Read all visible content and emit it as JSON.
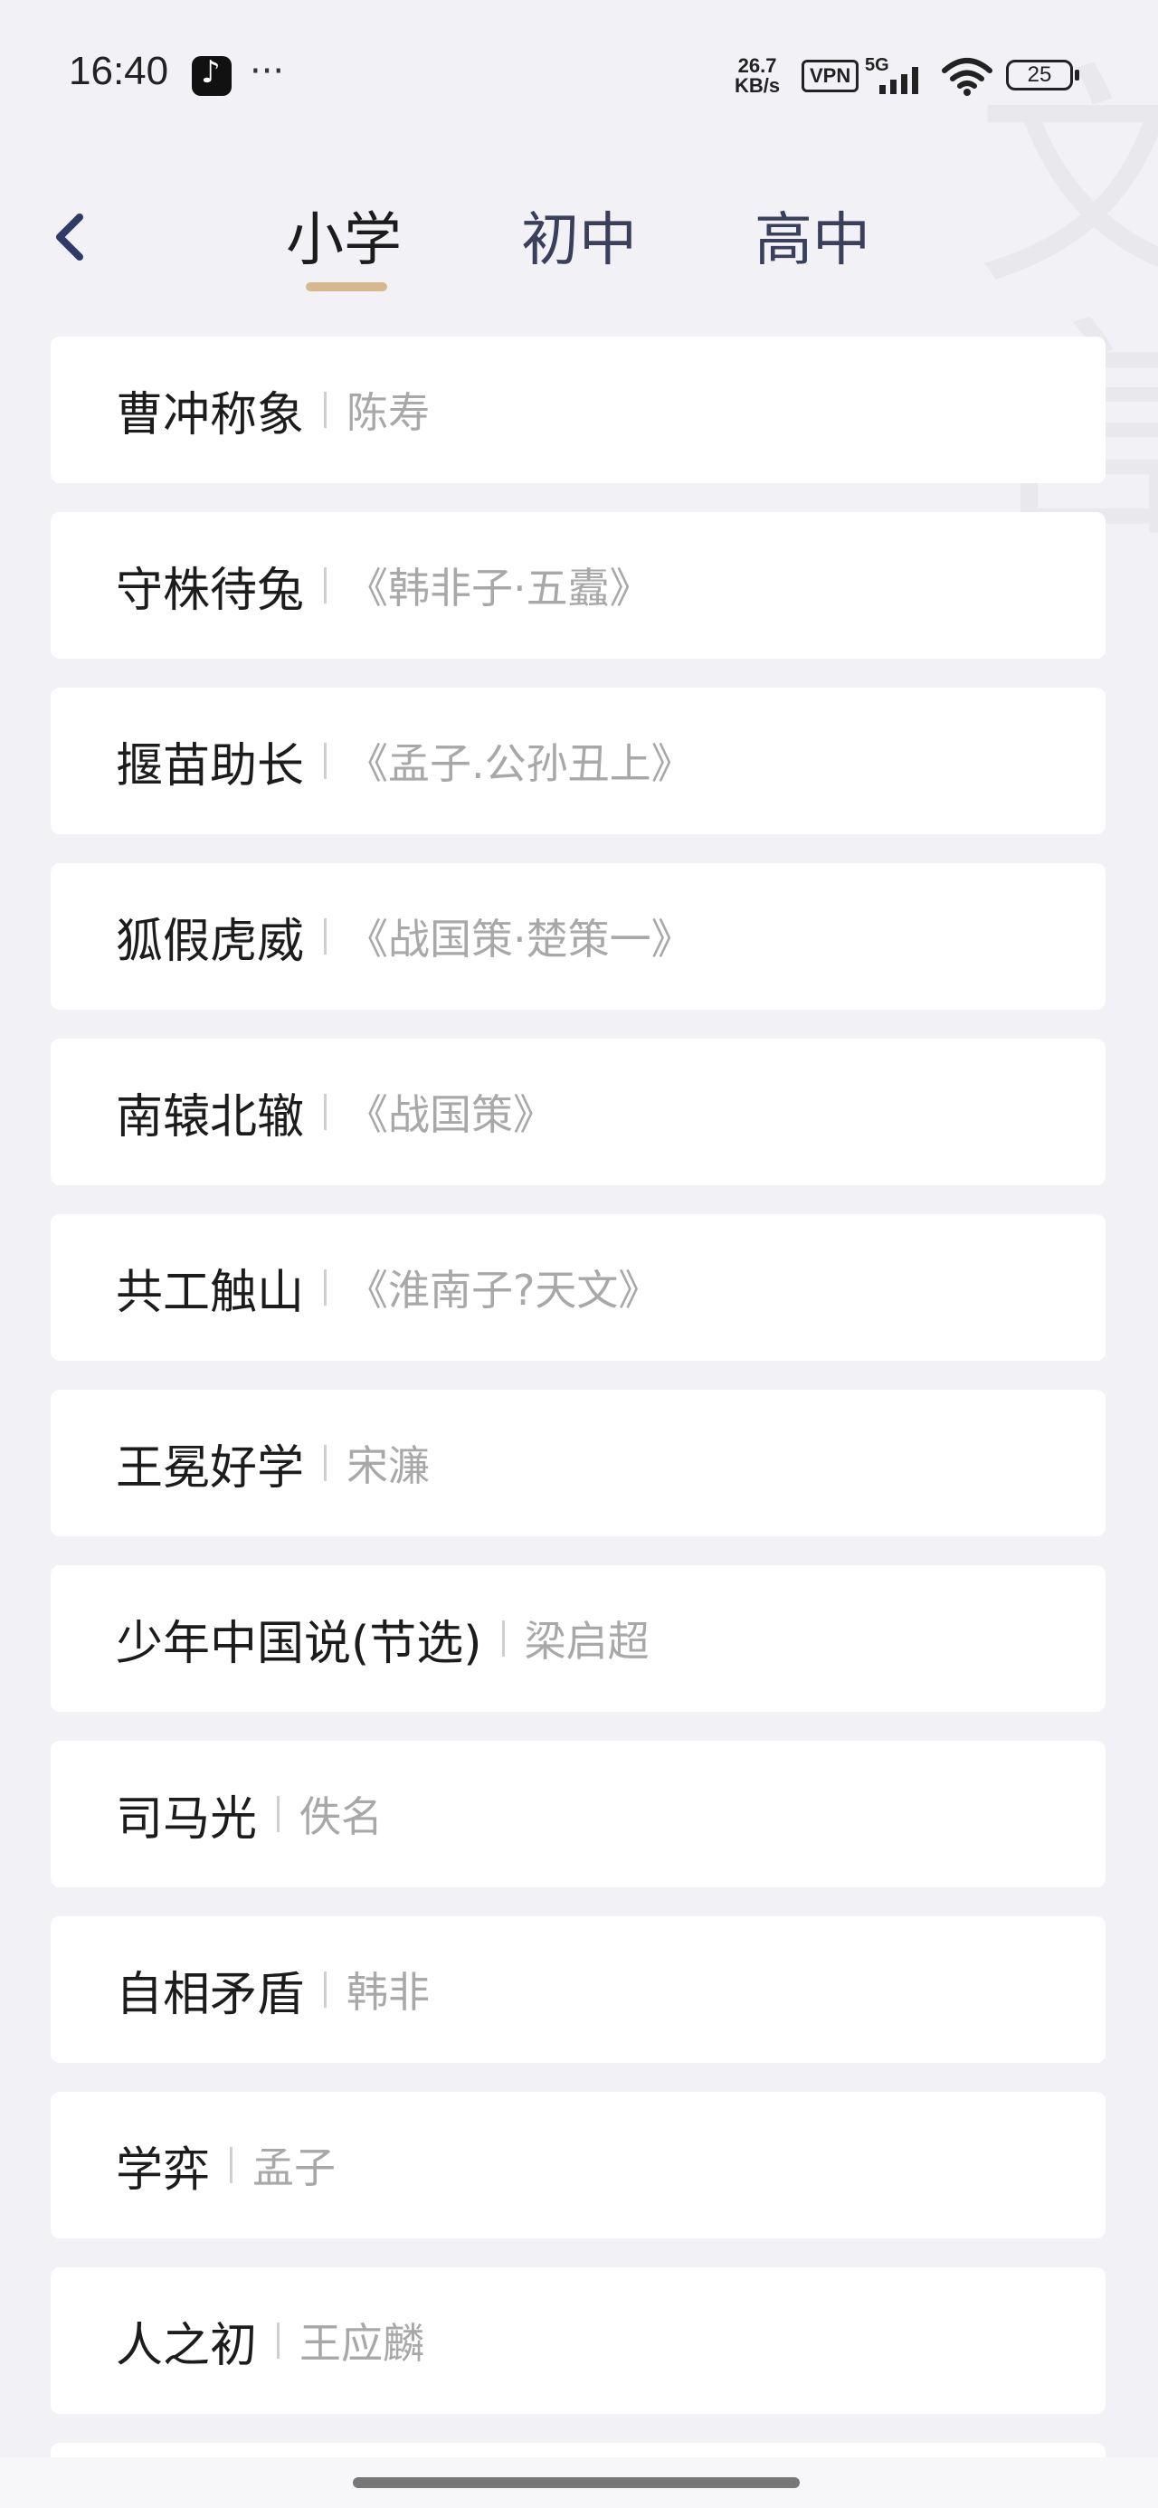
{
  "status_bar": {
    "time": "16:40",
    "more": "···",
    "net_speed_value": "26.7",
    "net_speed_unit": "KB/s",
    "vpn": "VPN",
    "network": "5G",
    "battery": "25"
  },
  "header": {
    "tabs": [
      {
        "label": "小学",
        "active": true
      },
      {
        "label": "初中",
        "active": false
      },
      {
        "label": "高中",
        "active": false
      }
    ],
    "accent_color": "#d6b88e"
  },
  "watermark": "文言",
  "items": [
    {
      "title": "曹冲称象",
      "source": "陈寿"
    },
    {
      "title": "守株待兔",
      "source": "《韩非子·五蠹》"
    },
    {
      "title": "揠苗助长",
      "source": "《孟子.公孙丑上》"
    },
    {
      "title": "狐假虎威",
      "source": "《战国策·楚策一》"
    },
    {
      "title": "南辕北辙",
      "source": "《战国策》"
    },
    {
      "title": "共工触山",
      "source": "《淮南子?天文》"
    },
    {
      "title": "王冕好学",
      "source": "宋濂"
    },
    {
      "title": "少年中国说(节选)",
      "source": "梁启超"
    },
    {
      "title": "司马光",
      "source": "佚名"
    },
    {
      "title": "自相矛盾",
      "source": "韩非"
    },
    {
      "title": "学弈",
      "source": "孟子"
    },
    {
      "title": "人之初",
      "source": "王应麟"
    }
  ]
}
